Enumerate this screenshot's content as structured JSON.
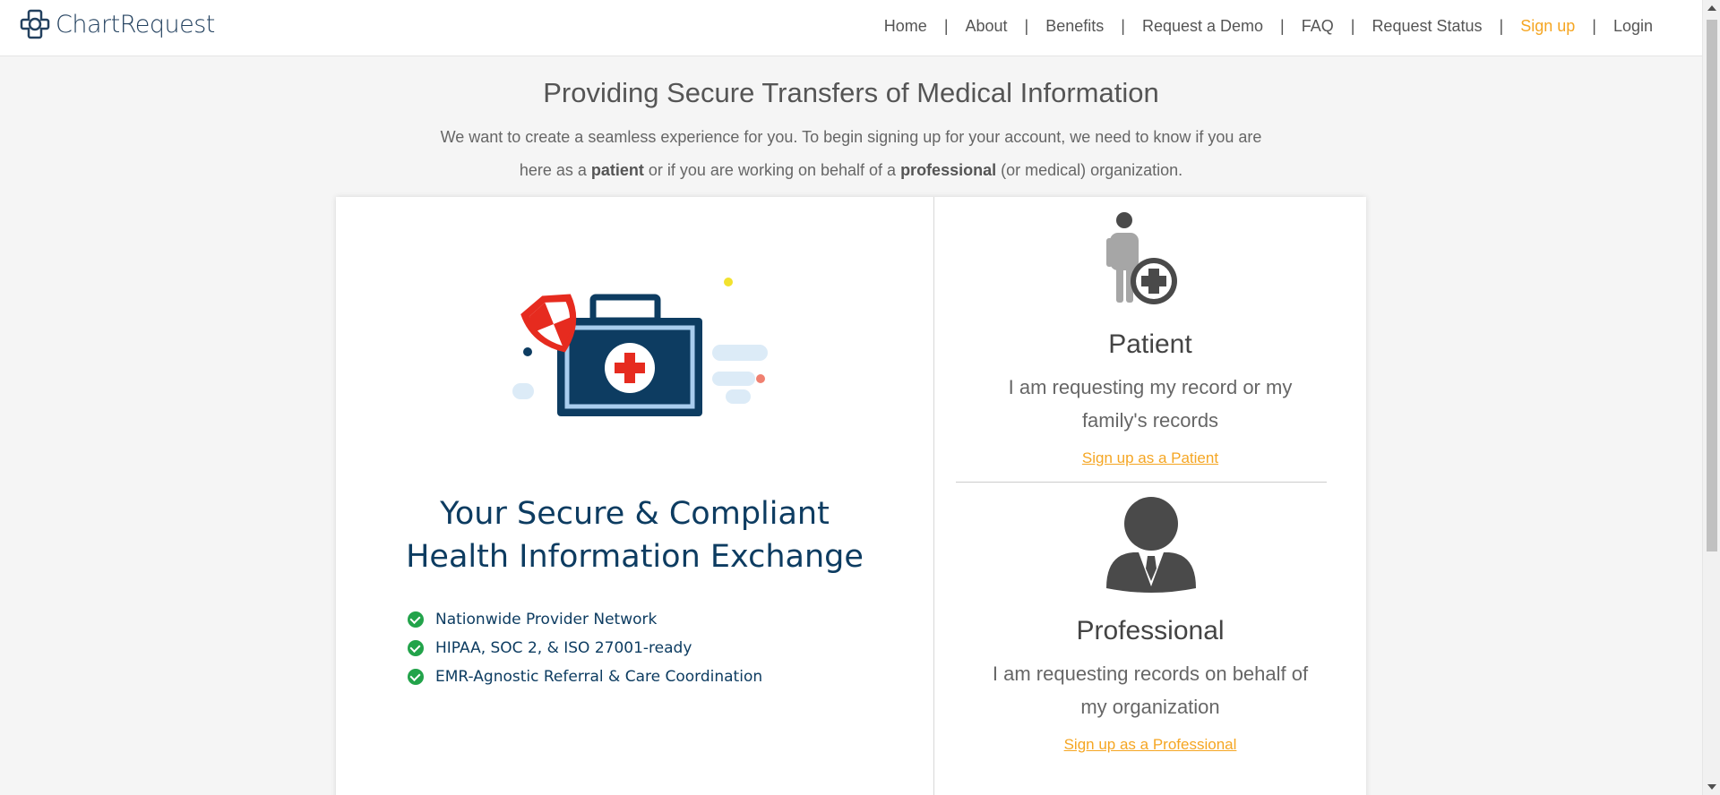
{
  "header": {
    "logo_text": "ChartRequest",
    "nav": [
      {
        "label": "Home"
      },
      {
        "label": "About"
      },
      {
        "label": "Benefits"
      },
      {
        "label": "Request a Demo"
      },
      {
        "label": "FAQ"
      },
      {
        "label": "Request Status"
      },
      {
        "label": "Sign up",
        "active": true
      },
      {
        "label": "Login"
      }
    ],
    "separator": "|"
  },
  "intro": {
    "title": "Providing Secure Transfers of Medical Information",
    "line1": "We want to create a seamless experience for you. To begin signing up for your account, we need to know if you are",
    "line2_pre": "here as a ",
    "patient_word": "patient",
    "line2_mid": " or if you are working on behalf of a ",
    "professional_word": "professional",
    "line2_post": " (or medical) organization."
  },
  "left_panel": {
    "title_line1": "Your Secure & Compliant",
    "title_line2": "Health Information Exchange",
    "features": [
      "Nationwide Provider Network",
      "HIPAA, SOC 2, & ISO 27001-ready",
      "EMR-Agnostic Referral & Care Coordination"
    ]
  },
  "patient": {
    "title": "Patient",
    "description": "I am requesting my record or my family's records",
    "link": "Sign up as a Patient"
  },
  "professional": {
    "title": "Professional",
    "description": "I am requesting records on behalf of my organization",
    "link": "Sign up as a Professional"
  },
  "colors": {
    "accent": "#f5a623",
    "navy": "#0d3c61",
    "check_green": "#22a34a",
    "background": "#f5f5f5"
  },
  "icons": [
    "chartrequest-logo-icon",
    "medical-kit-illustration",
    "check-circle-icon",
    "patient-icon",
    "professional-icon"
  ]
}
